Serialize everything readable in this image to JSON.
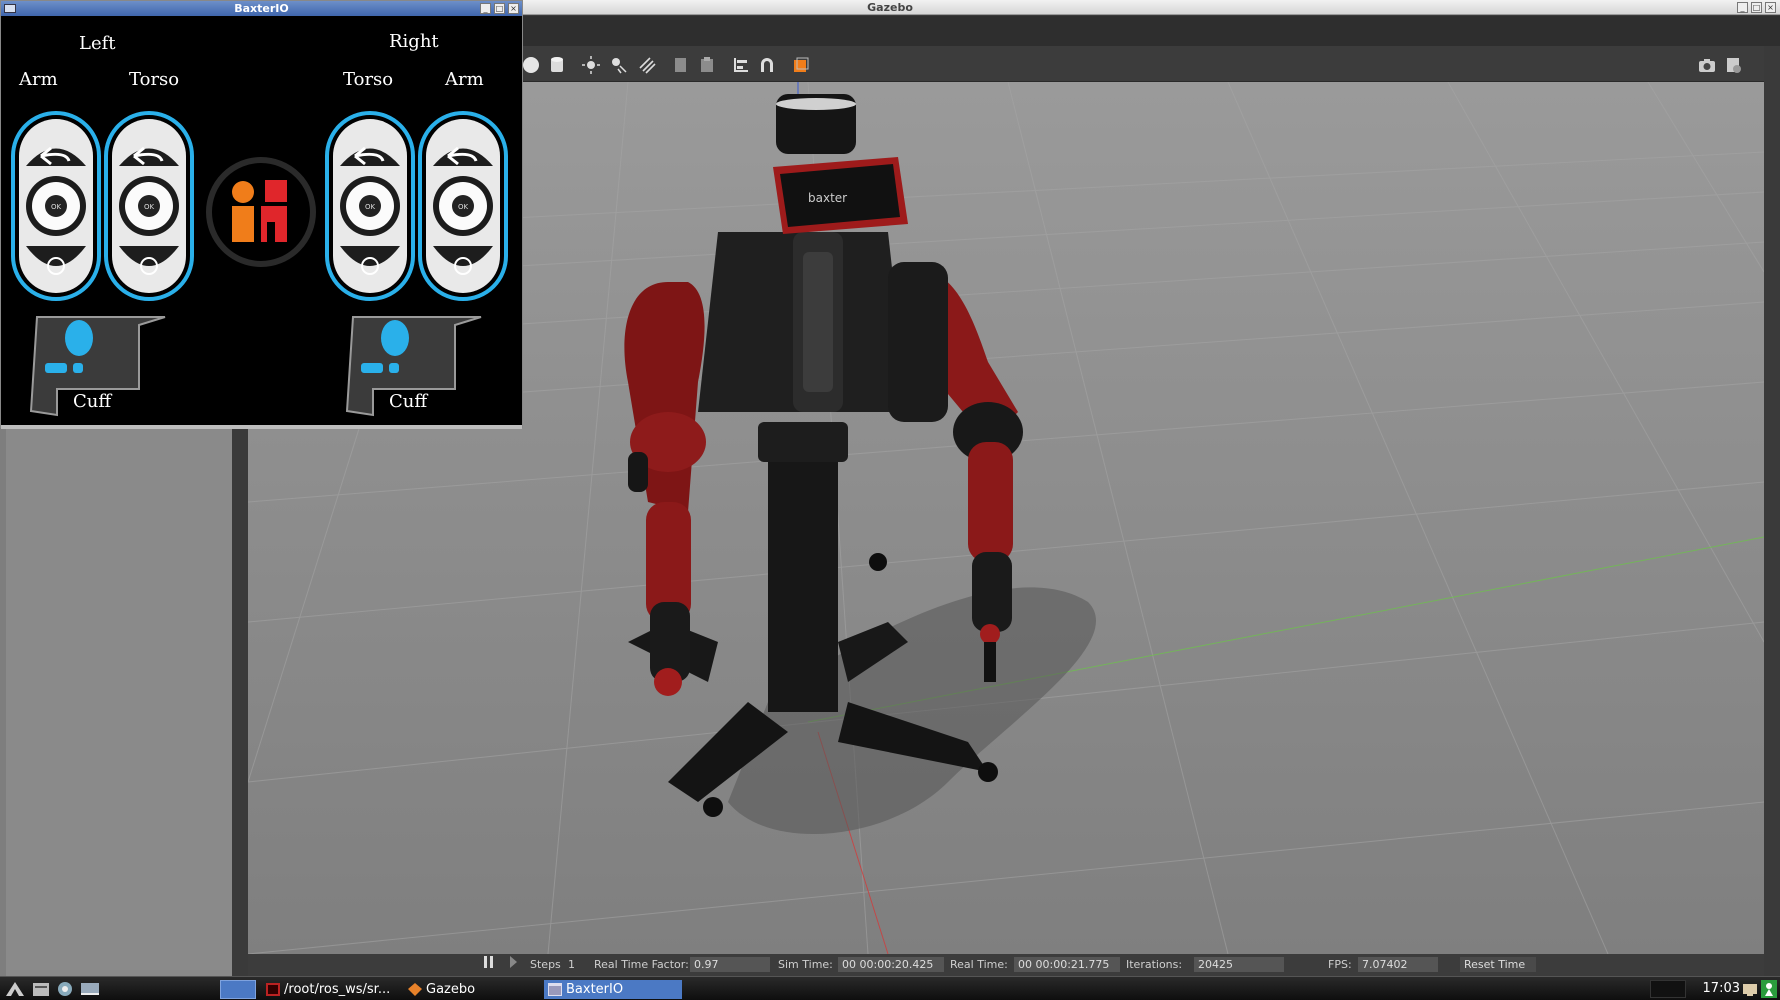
{
  "gazebo": {
    "title": "Gazebo",
    "status": {
      "steps_label": "Steps",
      "steps_value": "1",
      "rtf_label": "Real Time Factor:",
      "rtf_value": "0.97",
      "sim_label": "Sim Time:",
      "sim_value": "00 00:00:20.425",
      "real_label": "Real Time:",
      "real_value": "00 00:00:21.775",
      "iter_label": "Iterations:",
      "iter_value": "20425",
      "fps_label": "FPS:",
      "fps_value": "7.07402",
      "reset_label": "Reset Time"
    }
  },
  "baxter_io": {
    "title": "BaxterIO",
    "left_group": "Left",
    "right_group": "Right",
    "left_arm": "Arm",
    "left_torso": "Torso",
    "right_torso": "Torso",
    "right_arm": "Arm",
    "ok_label": "OK",
    "cuff_left": "Cuff",
    "cuff_right": "Cuff"
  },
  "robot_screen_text": "baxter",
  "taskbar": {
    "items": [
      {
        "label": "/root/ros_ws/sr..."
      },
      {
        "label": "Gazebo"
      },
      {
        "label": "BaxterIO"
      }
    ],
    "clock": "17:03"
  },
  "colors": {
    "accent_blue": "#2ab0ea",
    "logo_orange": "#f07d1a",
    "logo_red": "#e0262b",
    "robot_red": "#8b1a1a"
  }
}
